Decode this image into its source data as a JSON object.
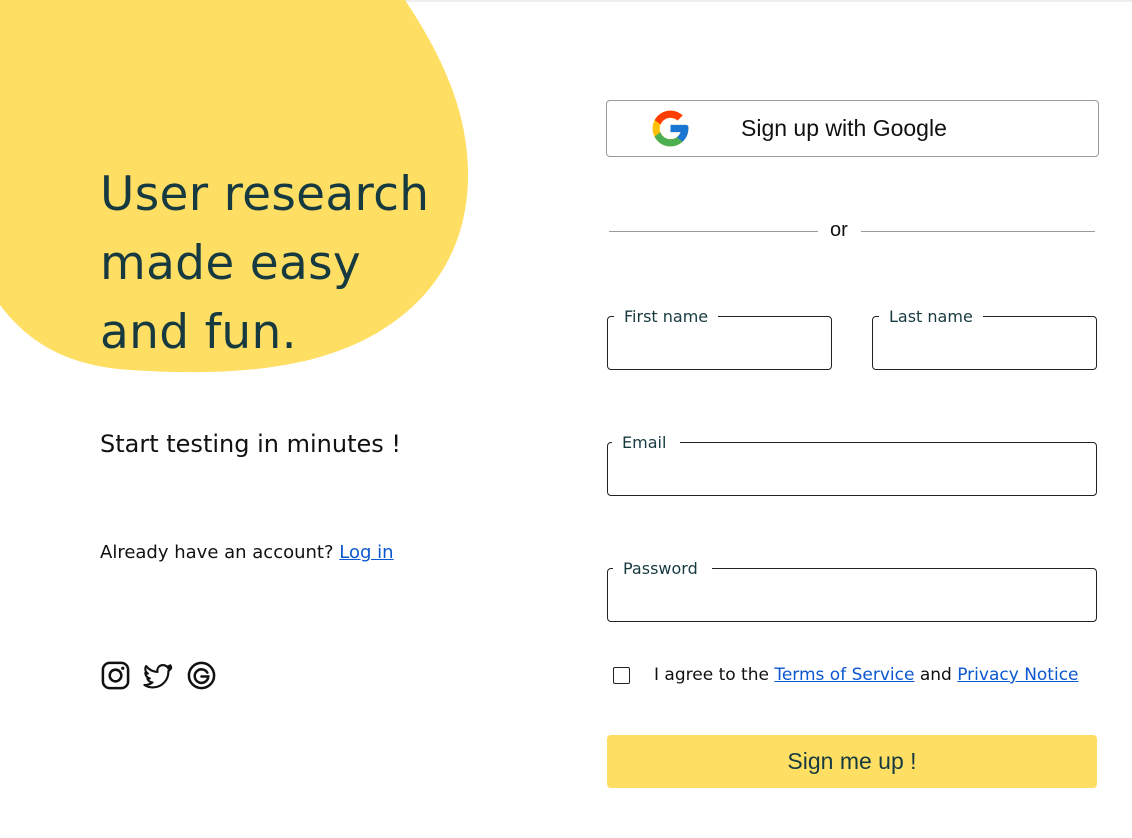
{
  "brand": {
    "accent_color": "#fedf64",
    "heading_color": "#173a40"
  },
  "hero": {
    "line1": "User research",
    "line2": "made easy",
    "line3": "and fun."
  },
  "tagline": "Start testing in minutes !",
  "account": {
    "prompt": "Already have an account?",
    "login_link": "Log in"
  },
  "social": {
    "icons": [
      "instagram-icon",
      "twitter-icon",
      "google-icon"
    ]
  },
  "signup": {
    "google_button": "Sign up with Google",
    "divider": "or",
    "fields": {
      "first_name": {
        "label": "First name",
        "value": ""
      },
      "last_name": {
        "label": "Last name",
        "value": ""
      },
      "email": {
        "label": "Email",
        "value": ""
      },
      "password": {
        "label": "Password",
        "value": ""
      }
    },
    "terms": {
      "checked": false,
      "prefix": "I agree to the",
      "tos_link": "Terms of Service",
      "and": "and",
      "privacy_link": "Privacy Notice"
    },
    "submit_label": "Sign me up !"
  }
}
